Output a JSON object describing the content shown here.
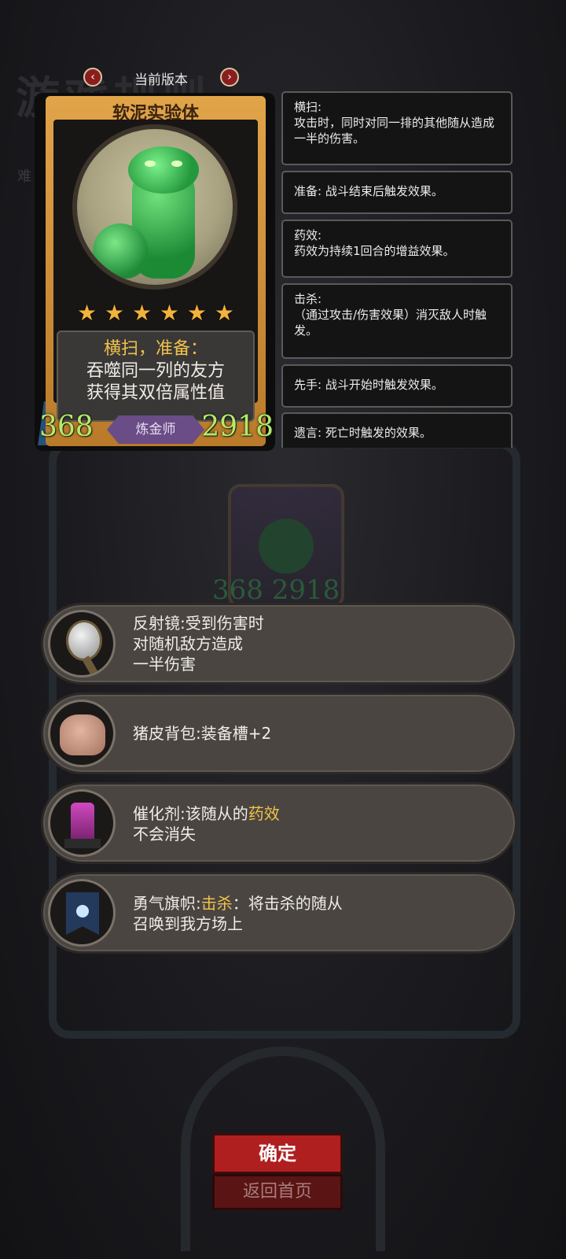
{
  "background": {
    "title": "游戏规则",
    "subtitle": "难"
  },
  "version": {
    "label": "当前版本"
  },
  "card": {
    "name": "软泥实验体",
    "stars": 6,
    "ability_title": "横扫，准备：",
    "ability_line1": "吞噬同一列的友方",
    "ability_line2": "获得其双倍属性值",
    "attack": "368",
    "health": "2918",
    "class_label": "炼金师"
  },
  "ghost": {
    "stats": "368 2918"
  },
  "keywords": [
    {
      "text": "横扫:\n攻击时，同时对同一排的其他随从造成一半的伤害。"
    },
    {
      "text": "准备: 战斗结束后触发效果。"
    },
    {
      "text": "药效:\n药效为持续1回合的增益效果。"
    },
    {
      "text": "击杀:\n（通过攻击/伤害效果）消灭敌人时触发。"
    },
    {
      "text": "先手: 战斗开始时触发效果。"
    },
    {
      "text": "遗言: 死亡时触发的效果。"
    }
  ],
  "equipment": [
    {
      "name": "反射镜",
      "line1": "反射镜:受到伤害时",
      "line2": "对随机敌方造成",
      "line3": "一半伤害"
    },
    {
      "name": "猪皮背包",
      "line1": "猪皮背包:装备槽+2"
    },
    {
      "name": "催化剂",
      "pre": "催化剂:该随从的",
      "hl": "药效",
      "line2": "不会消失"
    },
    {
      "name": "勇气旗帜",
      "pre": "勇气旗帜:",
      "hl": "击杀",
      "post": "：将击杀的随从",
      "line2": "召唤到我方场上"
    }
  ],
  "buttons": {
    "confirm": "确定",
    "home": "返回首页"
  },
  "colors": {
    "accent_gold": "#f0c24a",
    "stat_green": "#b6e86e",
    "confirm_red": "#b01f1f",
    "class_purple": "#6a4c86"
  }
}
